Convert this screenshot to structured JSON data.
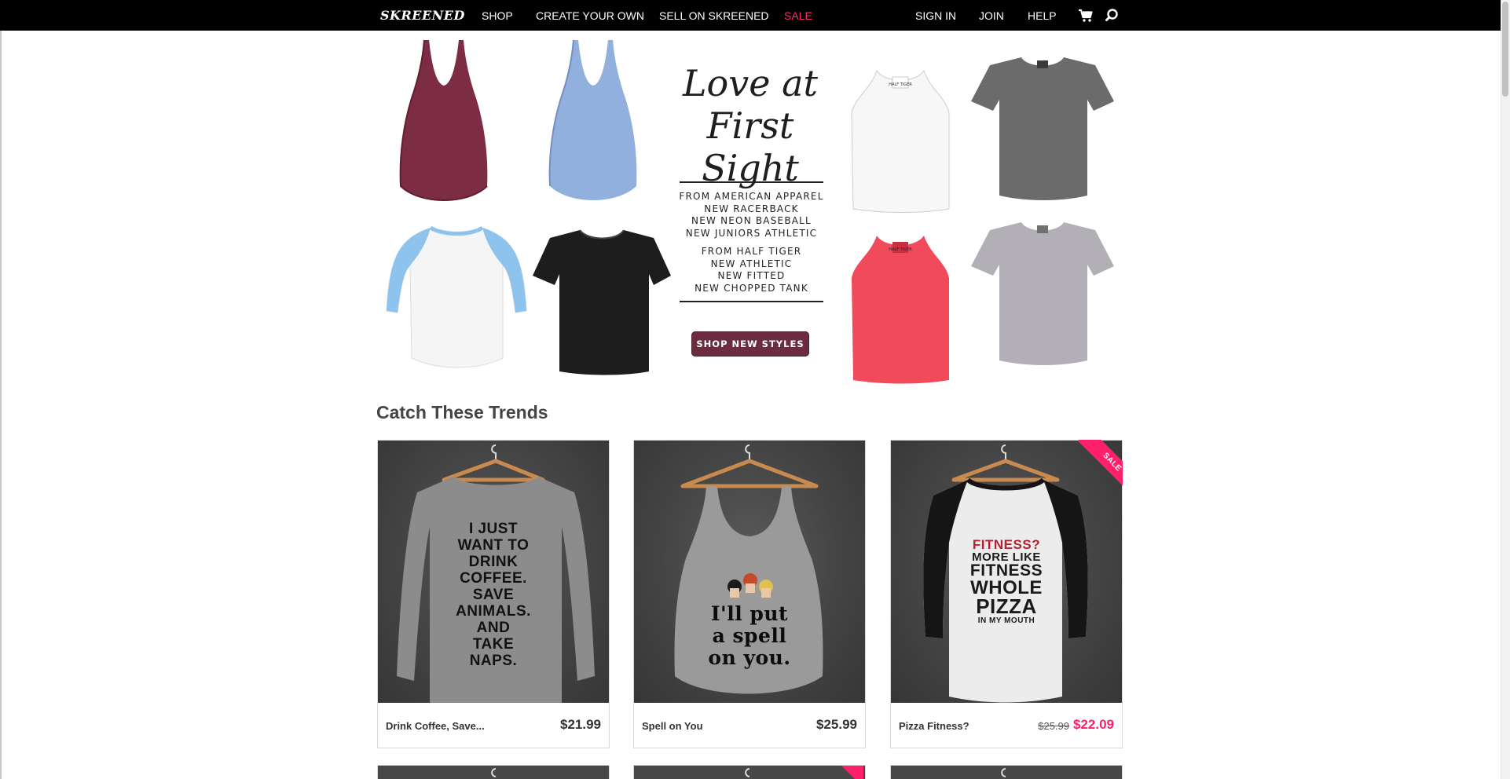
{
  "nav": {
    "logo": "SKREENED",
    "items": [
      "SHOP",
      "CREATE YOUR OWN",
      "SELL ON SKREENED",
      "SALE"
    ],
    "account": [
      "SIGN IN",
      "JOIN",
      "HELP"
    ],
    "cart_icon": "cart-icon",
    "search_icon": "search-icon",
    "sale_color": "#ff2a6d"
  },
  "hero": {
    "title_line1": "Love at",
    "title_line2": "First Sight",
    "group1": [
      "FROM AMERICAN APPAREL",
      "NEW RACERBACK",
      "NEW NEON BASEBALL",
      "NEW JUNIORS ATHLETIC"
    ],
    "group2": [
      "FROM HALF TIGER",
      "NEW ATHLETIC",
      "NEW FITTED",
      "NEW CHOPPED TANK"
    ],
    "button": "SHOP NEW STYLES",
    "shirt_tag_text": "HALF TIGER",
    "button_color": "#6b2c3f"
  },
  "trends": {
    "title": "Catch These Trends",
    "products": [
      {
        "name": "Drink Coffee, Save...",
        "price": "$21.99",
        "shirt_text": [
          "I JUST",
          "WANT TO",
          "DRINK",
          "COFFEE.",
          "SAVE",
          "ANIMALS.",
          "AND TAKE",
          "NAPS."
        ]
      },
      {
        "name": "Spell on You",
        "price": "$25.99",
        "shirt_text": [
          "I'll put",
          "a spell",
          "on you."
        ]
      },
      {
        "name": "Pizza Fitness?",
        "old_price": "$25.99",
        "price": "$22.09",
        "badge": "SALE",
        "shirt_text_red": "FITNESS?",
        "shirt_text": [
          "MORE LIKE",
          "FITNESS",
          "WHOLE",
          "PIZZA"
        ],
        "shirt_small": "IN MY MOUTH"
      }
    ],
    "sale_color": "#ff1f6a"
  }
}
